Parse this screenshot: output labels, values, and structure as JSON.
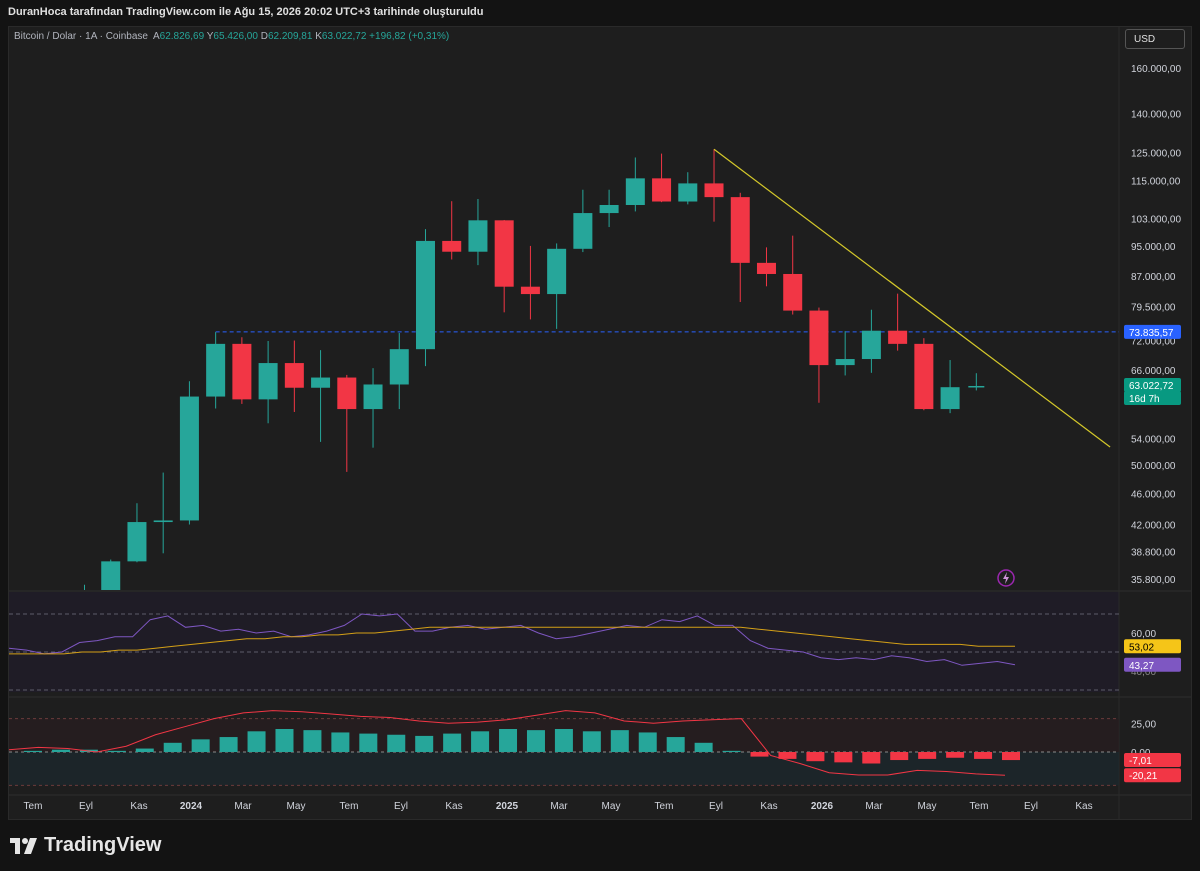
{
  "header": {
    "attribution": "DuranHoca tarafından TradingView.com ile Ağu 15, 2026 20:02 UTC+3 tarihinde oluşturuldu"
  },
  "legend": {
    "symbol": "Bitcoin / Dolar · 1A · Coinbase",
    "open_label": "A",
    "open": "62.826,69",
    "high_label": "Y",
    "high": "65.426,00",
    "low_label": "D",
    "low": "62.209,81",
    "close_label": "K",
    "close": "63.022,72",
    "change": "+196,82 (+0,31%)"
  },
  "currency_button": "USD",
  "footer": {
    "brand": "TradingView"
  },
  "colors": {
    "up": "#26a69a",
    "down": "#f23645",
    "trend": "#d4c82a",
    "rsi": "#7e57c2",
    "rsi_ma": "#d4a017",
    "price_tag": "#089981",
    "level_tag": "#2962ff"
  },
  "chart_data": [
    {
      "type": "candlestick",
      "symbol": "Bitcoin / Dolar",
      "interval": "1A",
      "exchange": "Coinbase",
      "price_scale": "log",
      "y_ticks": [
        "160.000,00",
        "140.000,00",
        "125.000,00",
        "115.000,00",
        "103.000,00",
        "95.000,00",
        "87.000,00",
        "79.500,00",
        "72.000,00",
        "66.000,00",
        "54.000,00",
        "50.000,00",
        "46.000,00",
        "42.000,00",
        "38.800,00",
        "35.800,00"
      ],
      "x_ticks": [
        "Tem",
        "Eyl",
        "Kas",
        "2024",
        "Mar",
        "May",
        "Tem",
        "Eyl",
        "Kas",
        "2025",
        "Mar",
        "May",
        "Tem",
        "Eyl",
        "Kas",
        "2026",
        "Mar",
        "May",
        "Tem",
        "Eyl",
        "Kas"
      ],
      "candles": [
        {
          "o": 33000,
          "h": 35200,
          "l": 30000,
          "c": 34500
        },
        {
          "o": 34500,
          "h": 37900,
          "l": 34000,
          "c": 37700
        },
        {
          "o": 37700,
          "h": 44700,
          "l": 37600,
          "c": 42300
        },
        {
          "o": 42300,
          "h": 48900,
          "l": 38600,
          "c": 42500
        },
        {
          "o": 42500,
          "h": 63900,
          "l": 42000,
          "c": 61100
        },
        {
          "o": 61100,
          "h": 73800,
          "l": 59000,
          "c": 71300
        },
        {
          "o": 71300,
          "h": 72700,
          "l": 59800,
          "c": 60600
        },
        {
          "o": 60600,
          "h": 71900,
          "l": 56500,
          "c": 67400
        },
        {
          "o": 67400,
          "h": 72000,
          "l": 58400,
          "c": 62700
        },
        {
          "o": 62700,
          "h": 70000,
          "l": 53500,
          "c": 64600
        },
        {
          "o": 64600,
          "h": 65100,
          "l": 49000,
          "c": 58900
        },
        {
          "o": 58900,
          "h": 66400,
          "l": 52600,
          "c": 63300
        },
        {
          "o": 63300,
          "h": 73600,
          "l": 58900,
          "c": 70200
        },
        {
          "o": 70200,
          "h": 99800,
          "l": 66800,
          "c": 96400
        },
        {
          "o": 96400,
          "h": 108300,
          "l": 91300,
          "c": 93400
        },
        {
          "o": 93400,
          "h": 109000,
          "l": 89800,
          "c": 102400
        },
        {
          "o": 102400,
          "h": 102500,
          "l": 78200,
          "c": 84300
        },
        {
          "o": 84300,
          "h": 95000,
          "l": 76600,
          "c": 82500
        },
        {
          "o": 82500,
          "h": 95700,
          "l": 74500,
          "c": 94200
        },
        {
          "o": 94200,
          "h": 112000,
          "l": 93300,
          "c": 104600
        },
        {
          "o": 104600,
          "h": 112000,
          "l": 100400,
          "c": 107100
        },
        {
          "o": 107100,
          "h": 123100,
          "l": 105100,
          "c": 115800
        },
        {
          "o": 115800,
          "h": 124500,
          "l": 108000,
          "c": 108200
        },
        {
          "o": 108200,
          "h": 117900,
          "l": 107300,
          "c": 114100
        },
        {
          "o": 114100,
          "h": 126100,
          "l": 102000,
          "c": 109600
        },
        {
          "o": 109600,
          "h": 111000,
          "l": 80600,
          "c": 90400
        },
        {
          "o": 90400,
          "h": 94600,
          "l": 84400,
          "c": 87500
        },
        {
          "o": 87500,
          "h": 97900,
          "l": 77700,
          "c": 78600
        },
        {
          "o": 78600,
          "h": 79300,
          "l": 60000,
          "c": 67000
        },
        {
          "o": 67000,
          "h": 74000,
          "l": 65000,
          "c": 68200
        },
        {
          "o": 68200,
          "h": 78800,
          "l": 65500,
          "c": 74100
        },
        {
          "o": 74100,
          "h": 82600,
          "l": 69900,
          "c": 71300
        },
        {
          "o": 71300,
          "h": 72500,
          "l": 58700,
          "c": 58900
        },
        {
          "o": 58900,
          "h": 68000,
          "l": 58200,
          "c": 62800
        },
        {
          "o": 62826.69,
          "h": 65426,
          "l": 62209.81,
          "c": 63022.72
        }
      ],
      "trendline": {
        "from": {
          "index": 24,
          "price": 126100
        },
        "to": {
          "index": 39.1,
          "price": 52700
        }
      },
      "horizontal_level": {
        "price": 73835.57,
        "label": "73.835,57",
        "from_index": 5
      },
      "last_price_label": "63.022,72",
      "countdown_label": "16d 7h"
    },
    {
      "type": "line",
      "name": "RSI",
      "y_ticks": [
        "60,00",
        "40,00"
      ],
      "bands": [
        70,
        50,
        30
      ],
      "series": [
        {
          "values": [
            52,
            51,
            49,
            50,
            55,
            56,
            58,
            58,
            67,
            69,
            63,
            64,
            61,
            62,
            60,
            61,
            58,
            59,
            61,
            64,
            70,
            69,
            70,
            61,
            61,
            63,
            64,
            62,
            63,
            64,
            60,
            57,
            58,
            60,
            62,
            64,
            63,
            67,
            66,
            69,
            64,
            64,
            56,
            52,
            51,
            50,
            47,
            46,
            47,
            46,
            48,
            47,
            45,
            46,
            43,
            44,
            45,
            43.27
          ]
        },
        {
          "values": [
            49,
            49,
            49,
            49,
            50,
            50,
            51,
            51,
            52,
            53,
            54,
            55,
            56,
            57,
            57,
            58,
            58,
            59,
            59,
            60,
            60,
            61,
            62,
            63,
            63,
            63,
            63,
            63,
            63,
            63,
            63,
            63,
            63,
            63,
            63,
            63,
            63,
            63,
            63,
            63,
            63,
            62,
            61,
            60,
            59,
            58,
            57,
            56,
            55,
            54,
            54,
            54,
            54,
            53,
            53,
            53.02
          ]
        }
      ],
      "value_labels": [
        "53,02",
        "43,27"
      ]
    },
    {
      "type": "bar",
      "name": "Oscillator",
      "y_ticks": [
        "25,00",
        "0,00"
      ],
      "values": [
        1,
        2,
        2,
        1,
        3,
        8,
        11,
        13,
        18,
        20,
        19,
        17,
        16,
        15,
        14,
        16,
        18,
        20,
        19,
        20,
        18,
        19,
        17,
        13,
        8,
        1,
        -4,
        -6,
        -8,
        -9,
        -10,
        -7,
        -6,
        -5,
        -6,
        -7.01
      ],
      "signal": [
        2,
        4,
        3,
        0,
        5,
        15,
        22,
        29,
        34,
        36,
        35,
        33,
        31,
        30,
        27,
        25,
        26,
        28,
        32,
        36,
        34,
        27,
        25,
        27,
        28,
        29,
        -3,
        -10,
        -18,
        -20,
        -20,
        -16,
        -17,
        -19,
        -20.21
      ],
      "value_labels": [
        "-7,01",
        "-20,21"
      ]
    }
  ]
}
